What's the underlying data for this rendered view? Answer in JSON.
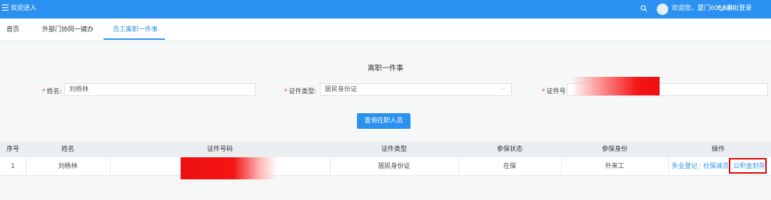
{
  "topbar": {
    "menu_icon": "hamburger-icon",
    "title": "欢迎进入",
    "search_icon": "search-icon",
    "welcome": "欢迎您，厦门605644",
    "logout": "退出登录",
    "logout_icon": "power-icon"
  },
  "tabs": [
    {
      "label": "首页"
    },
    {
      "label": "外部门协同一键办"
    },
    {
      "label": "员工离职一件事",
      "active": true
    }
  ],
  "form": {
    "title": "离职一件事",
    "name_label": "姓名:",
    "name_value": "刘杨林",
    "id_type_label": "证件类型:",
    "id_type_value": "居民身份证",
    "id_no_label": "证件号",
    "submit": "查询在职人员"
  },
  "table": {
    "headers": [
      "序号",
      "姓名",
      "证件号码",
      "证件类型",
      "参保状态",
      "参保身份",
      "操作"
    ],
    "rows": [
      {
        "index": "1",
        "name": "刘杨林",
        "id_type": "居民身份证",
        "status": "在保",
        "identity": "外来工",
        "ops": [
          "失业登记",
          "社保减员",
          "公积金封存"
        ]
      }
    ]
  },
  "colors": {
    "primary": "#2b91f0",
    "required": "#e23b3b",
    "highlight": "#e00000"
  }
}
